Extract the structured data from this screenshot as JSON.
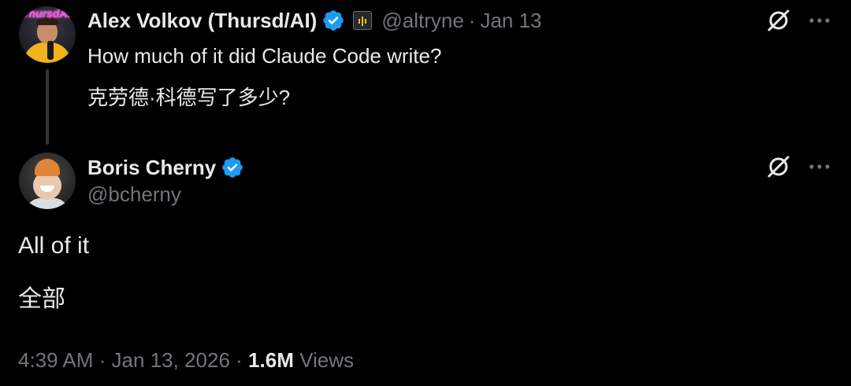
{
  "parent_tweet": {
    "author_name": "Alex Volkov (Thursd/AI)",
    "avatar_brand_text": "ThursdAI",
    "handle": "@altryne",
    "separator": "·",
    "date": "Jan 13",
    "text_en": "How much of it did Claude Code write?",
    "text_zh": "克劳德·科德写了多少?"
  },
  "main_tweet": {
    "author_name": "Boris Cherny",
    "handle": "@bcherny",
    "text_en": "All of it",
    "text_zh": "全部",
    "time": "4:39 AM",
    "separator": "·",
    "date": "Jan 13, 2026",
    "views_count": "1.6M",
    "views_label": "Views"
  },
  "icons": {
    "verified": "verified-badge-icon",
    "affiliation": "affiliation-badge-icon",
    "grok": "grok-icon",
    "more": "more-options-icon"
  },
  "colors": {
    "background": "#000000",
    "primary_text": "#e7e9ea",
    "secondary_text": "#71767b",
    "verified_blue": "#1d9bf0",
    "thread_line": "#333639"
  }
}
